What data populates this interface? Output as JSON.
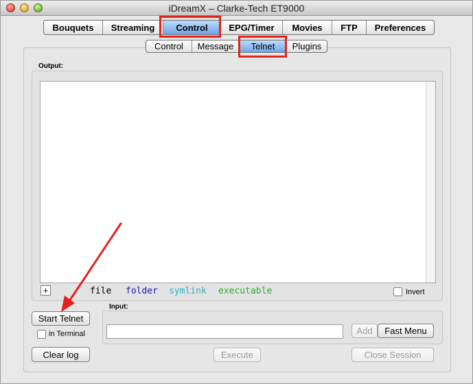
{
  "window": {
    "title": "iDreamX – Clarke-Tech ET9000"
  },
  "main_tabs": [
    {
      "label": "Bouquets"
    },
    {
      "label": "Streaming"
    },
    {
      "label": "Control",
      "selected": true
    },
    {
      "label": "EPG/Timer"
    },
    {
      "label": "Movies"
    },
    {
      "label": "FTP"
    },
    {
      "label": "Preferences"
    }
  ],
  "sub_tabs": [
    {
      "label": "Control"
    },
    {
      "label": "Message"
    },
    {
      "label": "Telnet",
      "selected": true
    },
    {
      "label": "Plugins"
    }
  ],
  "output": {
    "label": "Output:",
    "legend": {
      "file": "file",
      "folder": "folder",
      "symlink": "symlink",
      "executable": "executable"
    },
    "legend_colors": {
      "file": "#000000",
      "folder": "#1a1ab0",
      "symlink": "#2ab0c0",
      "executable": "#2ab02a"
    },
    "plus": "+",
    "invert_label": "Invert"
  },
  "telnet": {
    "start_label": "Start Telnet",
    "in_terminal_label": "in Terminal",
    "clear_log_label": "Clear log"
  },
  "input": {
    "label": "Input:",
    "value": "",
    "add_label": "Add",
    "fast_menu_label": "Fast Menu",
    "execute_label": "Execute",
    "close_session_label": "Close Session"
  },
  "highlight_color": "#e2231a"
}
